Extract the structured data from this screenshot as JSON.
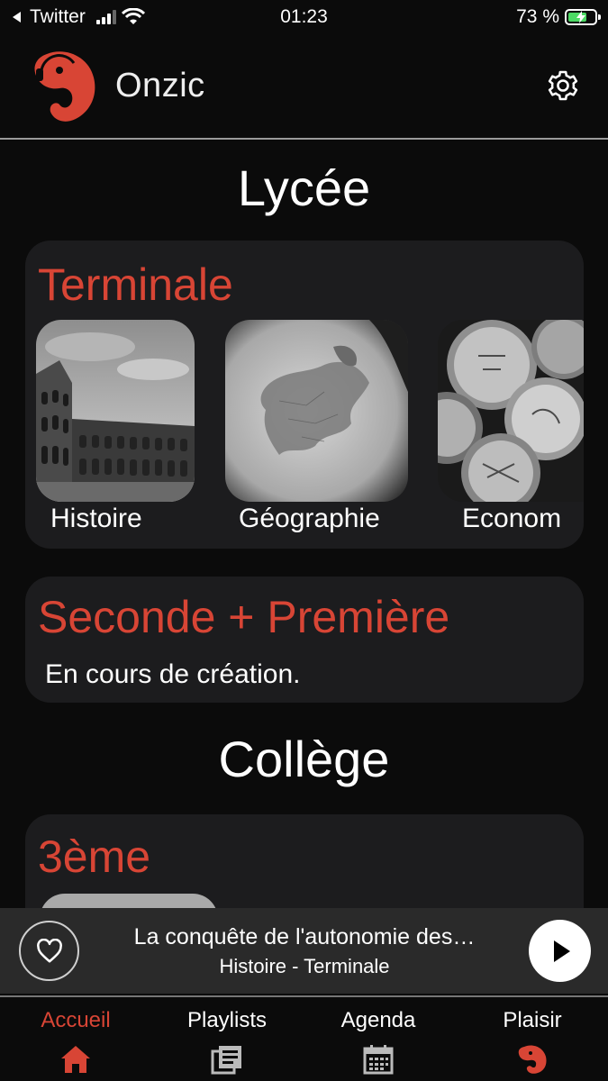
{
  "status_bar": {
    "back_app": "Twitter",
    "time": "01:23",
    "battery_percent": "73 %",
    "battery_level": 0.73
  },
  "header": {
    "app_name": "Onzic"
  },
  "sections": [
    {
      "title": "Lycée",
      "cards": [
        {
          "title": "Terminale",
          "subjects": [
            {
              "label": "Histoire",
              "image": "colosseum-photo"
            },
            {
              "label": "Géographie",
              "image": "globe-europe-photo"
            },
            {
              "label": "Econom",
              "image": "coins-photo"
            }
          ]
        },
        {
          "title": "Seconde + Première",
          "note": "En cours de création."
        }
      ]
    },
    {
      "title": "Collège",
      "cards": [
        {
          "title": "3ème"
        }
      ]
    }
  ],
  "player": {
    "track_title": "La conquête de l'autonomie des…",
    "track_subtitle": "Histoire - Terminale",
    "favorite_icon": "heart-outline-icon",
    "play_icon": "play-icon"
  },
  "nav": {
    "items": [
      {
        "label": "Accueil",
        "icon": "home-icon",
        "active": true
      },
      {
        "label": "Playlists",
        "icon": "playlist-icon",
        "active": false
      },
      {
        "label": "Agenda",
        "icon": "calendar-icon",
        "active": false
      },
      {
        "label": "Plaisir",
        "icon": "elephant-icon",
        "active": false
      }
    ]
  },
  "colors": {
    "accent": "#d84535",
    "background": "#0b0b0b",
    "card": "#1c1c1e",
    "player_bg": "#2a2a2a"
  }
}
